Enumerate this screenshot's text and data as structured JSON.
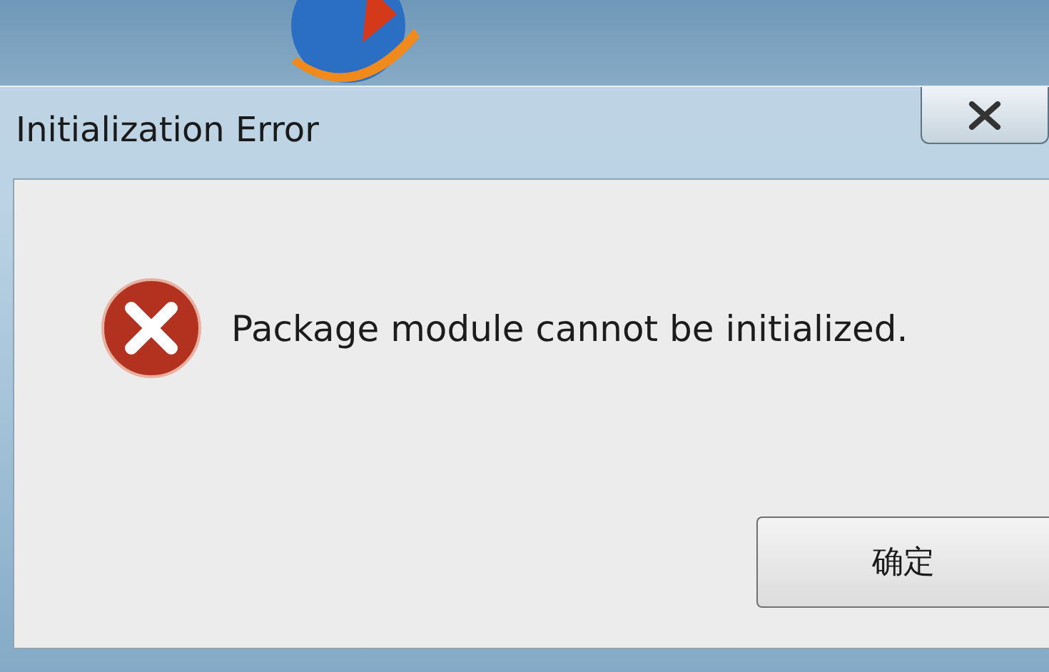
{
  "window": {
    "title": "Initialization Error"
  },
  "message": "Package module cannot be initialized.",
  "buttons": [
    "确定"
  ]
}
